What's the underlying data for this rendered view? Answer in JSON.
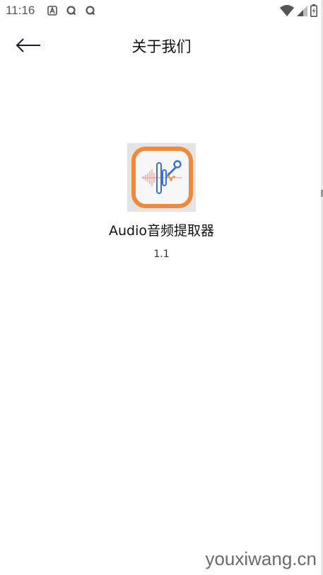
{
  "status_bar": {
    "time": "11:16",
    "left_icons": [
      "a-icon",
      "q-icon",
      "q-icon"
    ],
    "right_icons": [
      "wifi-icon",
      "cellular-icon",
      "battery-icon"
    ]
  },
  "app_bar": {
    "back_icon": "arrow-left-icon",
    "title": "关于我们"
  },
  "about": {
    "app_icon": "audio-waveform-icon",
    "app_name": "Audio音频提取器",
    "version": "1.1"
  },
  "watermark": "youxiwang.cn",
  "colors": {
    "icon_border": "#ef8a3c",
    "icon_blue": "#3a6fd8",
    "text": "#111111",
    "background": "#ffffff"
  }
}
